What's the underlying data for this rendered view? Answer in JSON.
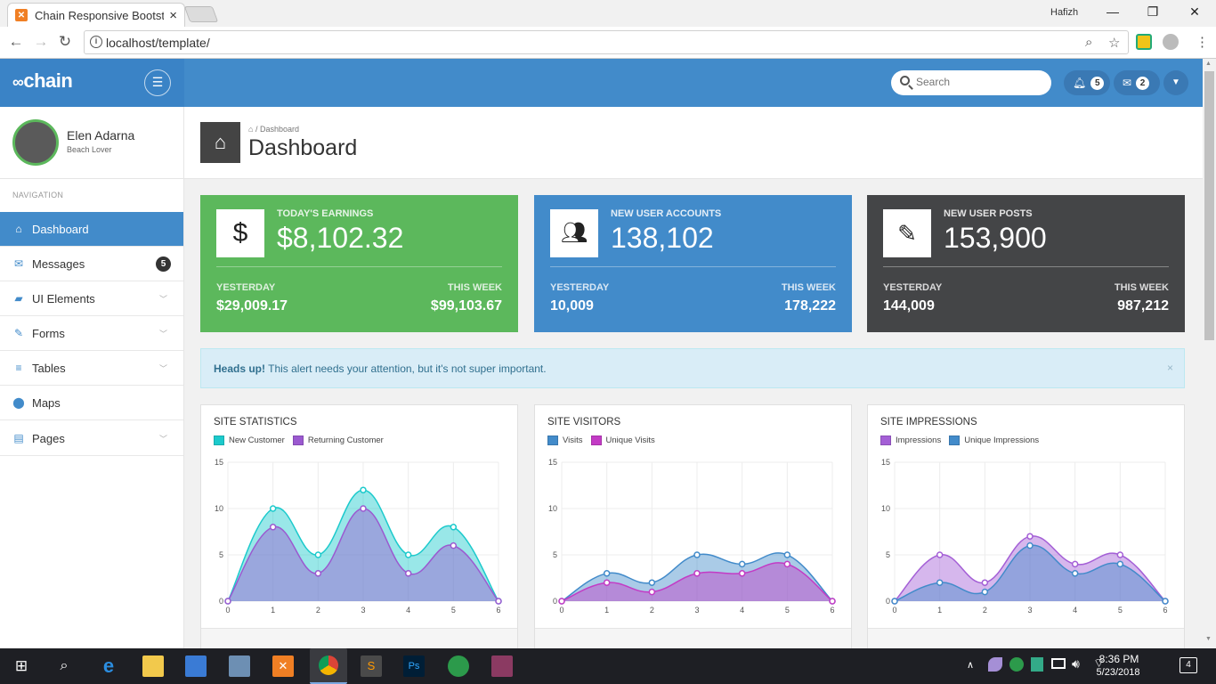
{
  "browser": {
    "tab_title": "Chain Responsive Bootstr",
    "tab_close": "×",
    "user_label": "Hafizh",
    "url": "localhost/template/",
    "win_minimize": "—",
    "win_restore": "❐",
    "win_close": "✕"
  },
  "header": {
    "logo": "chain",
    "search_placeholder": "Search",
    "notifications_count": "5",
    "messages_count": "2"
  },
  "profile": {
    "name": "Elen Adarna",
    "subtitle": "Beach Lover"
  },
  "sidebar": {
    "nav_header": "NAVIGATION",
    "items": [
      {
        "label": "Dashboard",
        "icon": "home-icon",
        "active": true
      },
      {
        "label": "Messages",
        "icon": "envelope-icon",
        "badge": "5"
      },
      {
        "label": "UI Elements",
        "icon": "briefcase-icon"
      },
      {
        "label": "Forms",
        "icon": "edit-icon"
      },
      {
        "label": "Tables",
        "icon": "list-icon"
      },
      {
        "label": "Maps",
        "icon": "map-marker-icon"
      },
      {
        "label": "Pages",
        "icon": "file-icon"
      }
    ]
  },
  "page": {
    "breadcrumb": "Dashboard",
    "title": "Dashboard"
  },
  "stats": [
    {
      "label": "TODAY'S EARNINGS",
      "value": "$8,102.32",
      "yesterday_label": "YESTERDAY",
      "yesterday": "$29,009.17",
      "week_label": "THIS WEEK",
      "week": "$99,103.67",
      "color": "#5cb85c",
      "icon": "dollar-icon"
    },
    {
      "label": "NEW USER ACCOUNTS",
      "value": "138,102",
      "yesterday_label": "YESTERDAY",
      "yesterday": "10,009",
      "week_label": "THIS WEEK",
      "week": "178,222",
      "color": "#428bca",
      "icon": "users-icon"
    },
    {
      "label": "NEW USER POSTS",
      "value": "153,900",
      "yesterday_label": "YESTERDAY",
      "yesterday": "144,009",
      "week_label": "THIS WEEK",
      "week": "987,212",
      "color": "#444547",
      "icon": "pencil-icon"
    }
  ],
  "alert": {
    "strong": "Heads up!",
    "text": " This alert needs your attention, but it's not super important.",
    "close": "×"
  },
  "chart_data": [
    {
      "type": "area",
      "title": "SITE STATISTICS",
      "x": [
        0,
        1,
        2,
        3,
        4,
        5,
        6
      ],
      "ylim": [
        0,
        15
      ],
      "yticks": [
        0,
        5,
        10,
        15
      ],
      "series": [
        {
          "name": "New Customer",
          "values": [
            0,
            10,
            5,
            12,
            5,
            8,
            0
          ],
          "color": "#1ccacc"
        },
        {
          "name": "Returning Customer",
          "values": [
            0,
            8,
            3,
            10,
            3,
            6,
            0
          ],
          "color": "#9b59d0"
        }
      ]
    },
    {
      "type": "area",
      "title": "SITE VISITORS",
      "x": [
        0,
        1,
        2,
        3,
        4,
        5,
        6
      ],
      "ylim": [
        0,
        15
      ],
      "yticks": [
        0,
        5,
        10,
        15
      ],
      "series": [
        {
          "name": "Visits",
          "values": [
            0,
            3,
            2,
            5,
            4,
            5,
            0
          ],
          "color": "#428bca"
        },
        {
          "name": "Unique Visits",
          "values": [
            0,
            2,
            1,
            3,
            3,
            4,
            0
          ],
          "color": "#c33bc5"
        }
      ]
    },
    {
      "type": "area",
      "title": "SITE IMPRESSIONS",
      "x": [
        0,
        1,
        2,
        3,
        4,
        5,
        6
      ],
      "ylim": [
        0,
        15
      ],
      "yticks": [
        0,
        5,
        10,
        15
      ],
      "series": [
        {
          "name": "Impressions",
          "values": [
            0,
            5,
            2,
            7,
            4,
            5,
            0
          ],
          "color": "#a45fd6"
        },
        {
          "name": "Unique Impressions",
          "values": [
            0,
            2,
            1,
            6,
            3,
            4,
            0
          ],
          "color": "#428bca"
        }
      ]
    }
  ],
  "taskbar": {
    "time": "8:36 PM",
    "date": "5/23/2018",
    "notif_count": "4"
  }
}
